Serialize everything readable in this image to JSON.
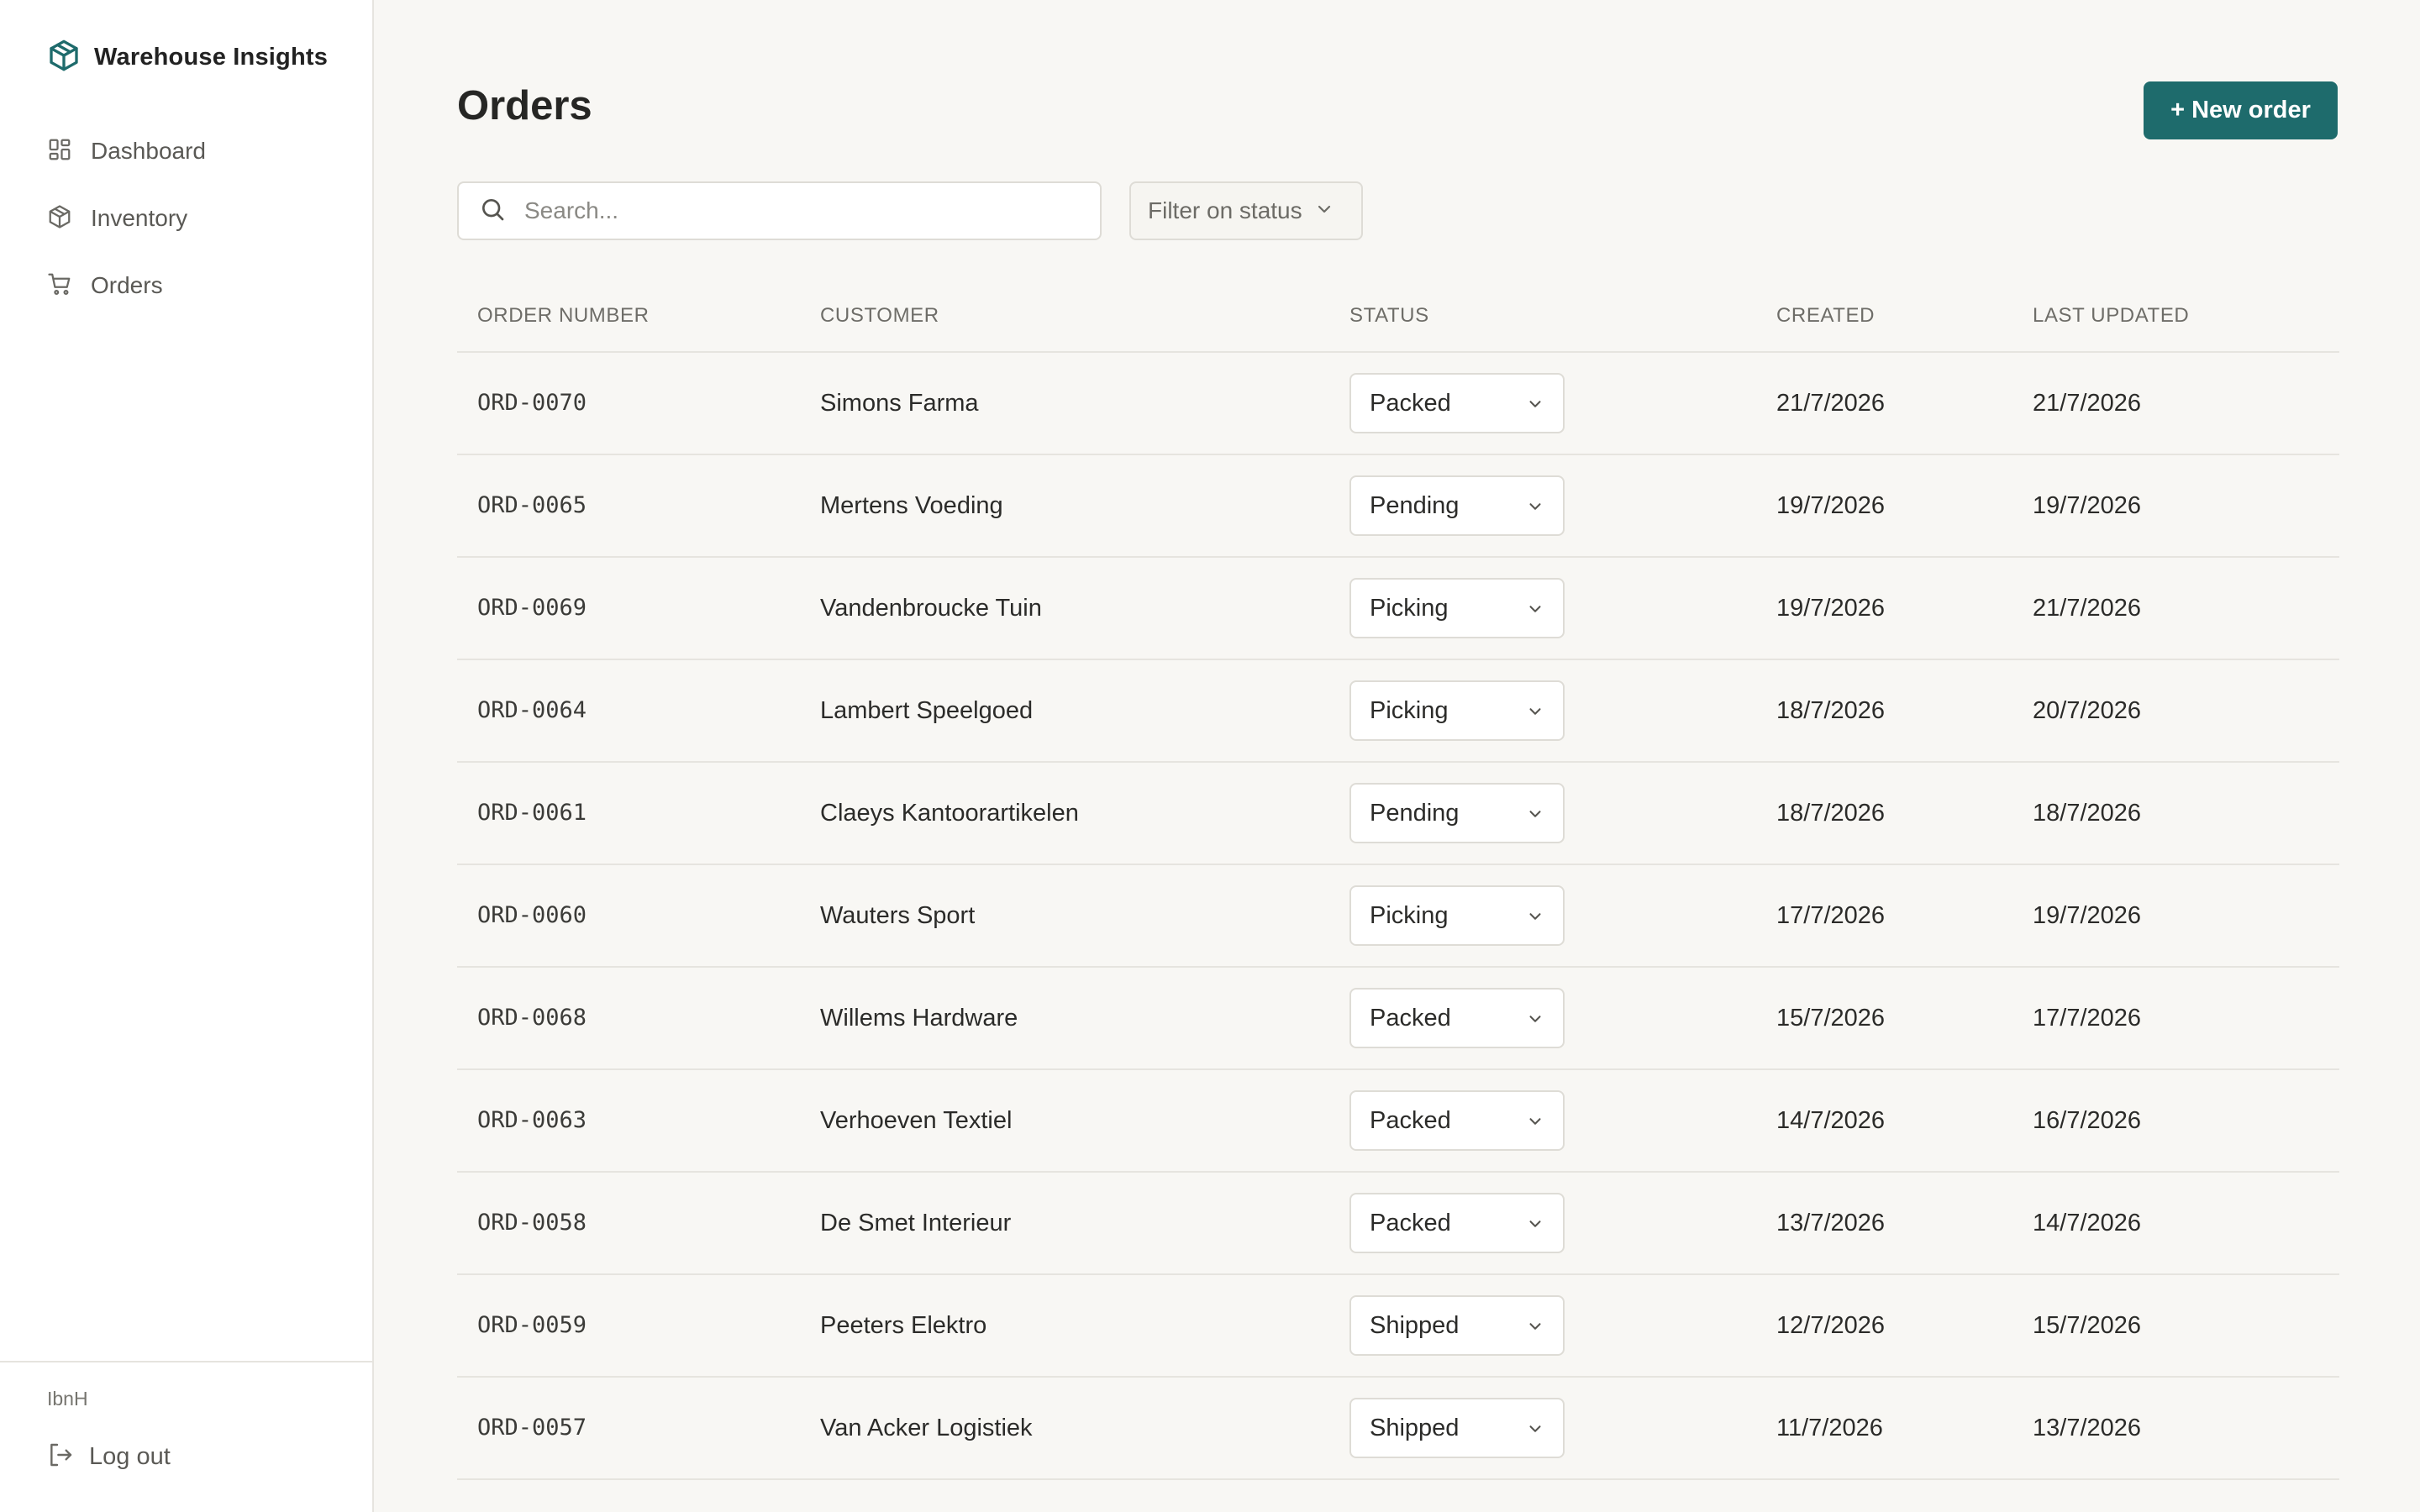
{
  "app": {
    "name": "Warehouse Insights"
  },
  "sidebar": {
    "items": [
      {
        "label": "Dashboard",
        "icon": "dashboard-icon"
      },
      {
        "label": "Inventory",
        "icon": "box-icon"
      },
      {
        "label": "Orders",
        "icon": "cart-icon"
      }
    ],
    "user": "IbnH",
    "logout_label": "Log out"
  },
  "main": {
    "title": "Orders",
    "new_order_label": "+ New order",
    "search_placeholder": "Search...",
    "filter_label": "Filter on status"
  },
  "table": {
    "columns": [
      "ORDER NUMBER",
      "CUSTOMER",
      "STATUS",
      "CREATED",
      "LAST UPDATED"
    ],
    "rows": [
      {
        "order": "ORD-0070",
        "customer": "Simons Farma",
        "status": "Packed",
        "created": "21/7/2026",
        "updated": "21/7/2026"
      },
      {
        "order": "ORD-0065",
        "customer": "Mertens Voeding",
        "status": "Pending",
        "created": "19/7/2026",
        "updated": "19/7/2026"
      },
      {
        "order": "ORD-0069",
        "customer": "Vandenbroucke Tuin",
        "status": "Picking",
        "created": "19/7/2026",
        "updated": "21/7/2026"
      },
      {
        "order": "ORD-0064",
        "customer": "Lambert Speelgoed",
        "status": "Picking",
        "created": "18/7/2026",
        "updated": "20/7/2026"
      },
      {
        "order": "ORD-0061",
        "customer": "Claeys Kantoorartikelen",
        "status": "Pending",
        "created": "18/7/2026",
        "updated": "18/7/2026"
      },
      {
        "order": "ORD-0060",
        "customer": "Wauters Sport",
        "status": "Picking",
        "created": "17/7/2026",
        "updated": "19/7/2026"
      },
      {
        "order": "ORD-0068",
        "customer": "Willems Hardware",
        "status": "Packed",
        "created": "15/7/2026",
        "updated": "17/7/2026"
      },
      {
        "order": "ORD-0063",
        "customer": "Verhoeven Textiel",
        "status": "Packed",
        "created": "14/7/2026",
        "updated": "16/7/2026"
      },
      {
        "order": "ORD-0058",
        "customer": "De Smet Interieur",
        "status": "Packed",
        "created": "13/7/2026",
        "updated": "14/7/2026"
      },
      {
        "order": "ORD-0059",
        "customer": "Peeters Elektro",
        "status": "Shipped",
        "created": "12/7/2026",
        "updated": "15/7/2026"
      },
      {
        "order": "ORD-0057",
        "customer": "Van Acker Logistiek",
        "status": "Shipped",
        "created": "11/7/2026",
        "updated": "13/7/2026"
      }
    ]
  },
  "colors": {
    "accent": "#1e6b6c",
    "background": "#f8f7f4",
    "border": "#e6e4df"
  }
}
